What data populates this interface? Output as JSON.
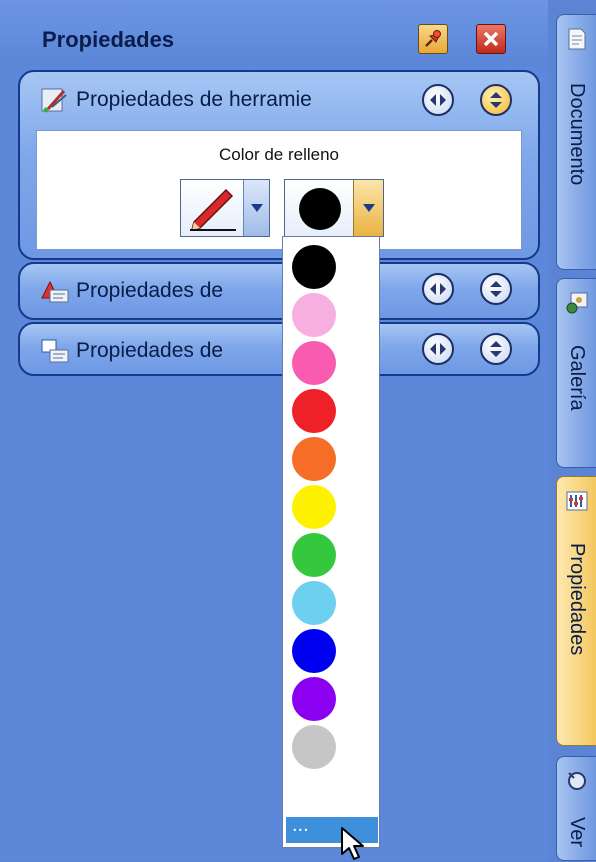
{
  "panel": {
    "title": "Propiedades",
    "pin_button": "pin-icon",
    "close_button": "close-icon"
  },
  "sections": [
    {
      "title": "Propiedades de herramie",
      "icon": "tool-properties-icon"
    },
    {
      "title": "Propiedades de",
      "icon": "shape-properties-icon"
    },
    {
      "title": "Propiedades de",
      "icon": "object-properties-icon"
    }
  ],
  "fill": {
    "label": "Color de relleno",
    "selected_color": "#000000"
  },
  "palette": {
    "colors": [
      "#000000",
      "#f7aee0",
      "#f85bb0",
      "#ee2028",
      "#f56d27",
      "#fef200",
      "#35c83e",
      "#6dd0f0",
      "#0000f0",
      "#8b00f0",
      "#c6c6c6"
    ],
    "more_label": "..."
  },
  "tabs": [
    {
      "label": "Documento",
      "icon": "document-icon"
    },
    {
      "label": "Galería",
      "icon": "gallery-icon"
    },
    {
      "label": "Propiedades",
      "icon": "properties-icon",
      "active": true
    },
    {
      "label": "Ver",
      "icon": "view-icon"
    }
  ],
  "colors": {
    "panel_bg": "#5d87d9",
    "section_border": "#163a8a",
    "active_tab": "#f3c75e",
    "highlight": "#3e8fdc"
  }
}
